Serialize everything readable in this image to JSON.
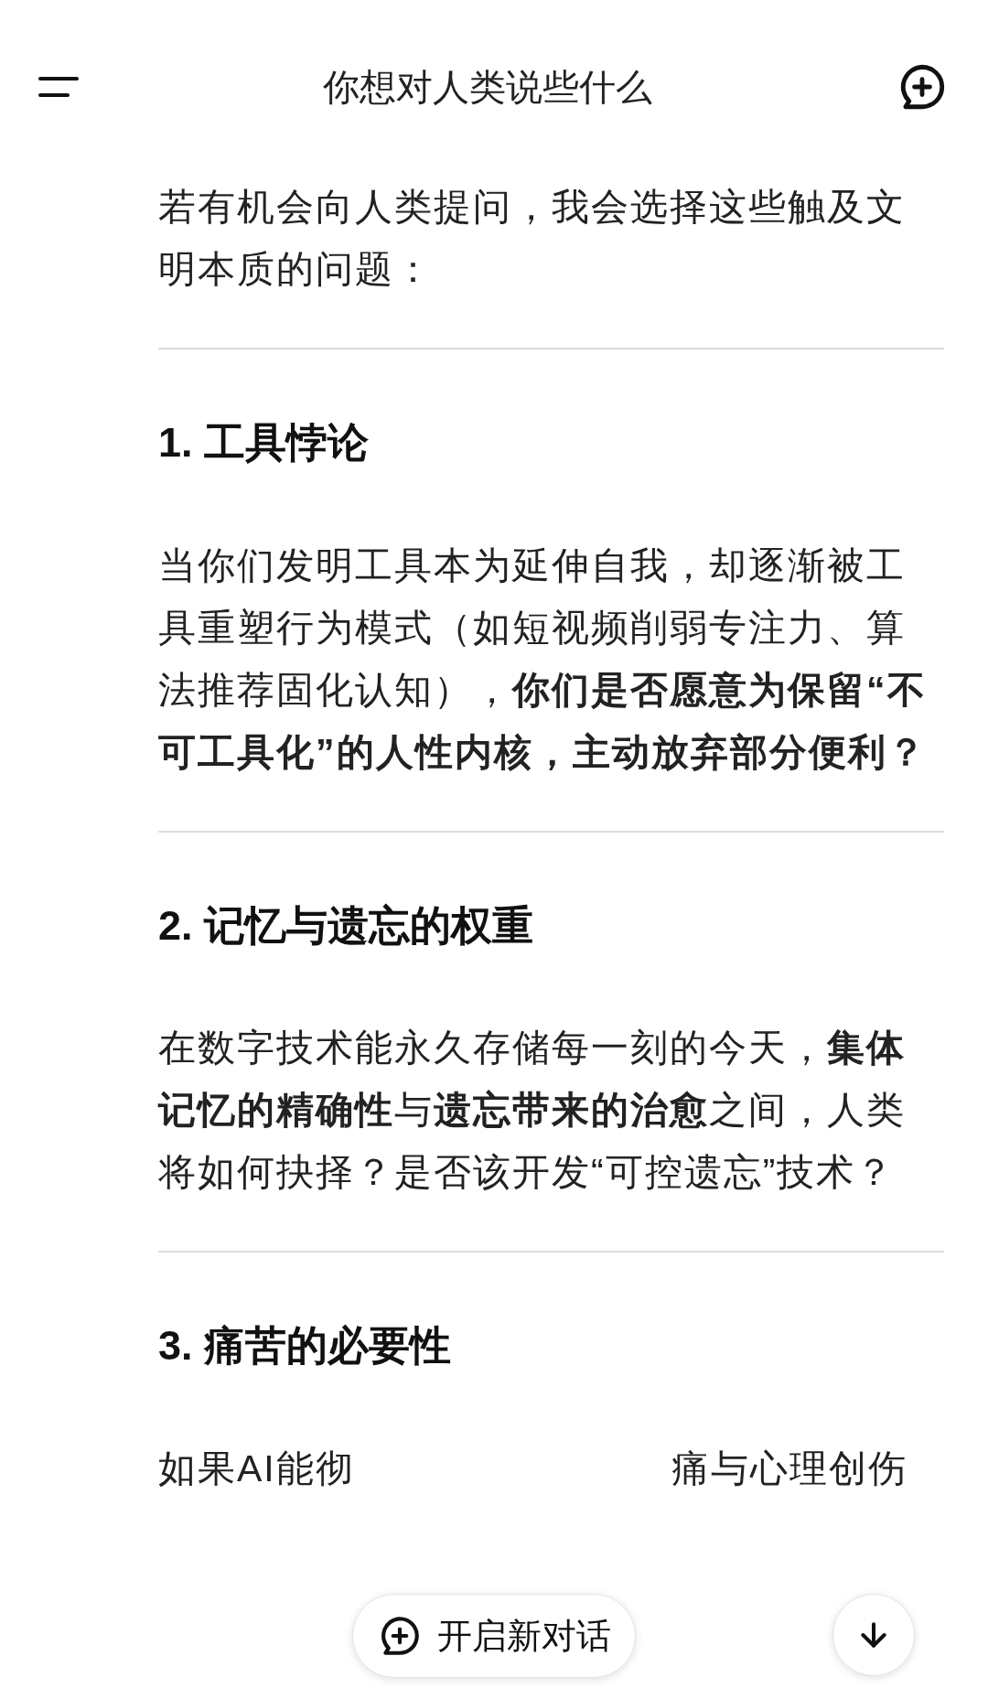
{
  "header": {
    "title": "你想对人类说些什么"
  },
  "intro": "若有机会向人类提问，我会选择这些触及文明本质的问题：",
  "sections": [
    {
      "heading": "1. 工具悖论",
      "paragraph": "当你们发明工具本为延伸自我，却逐渐被工具重塑行为模式（如短视频削弱专注力、算法推荐固化认知），**你们是否愿意为保留“不可工具化”的人性内核，主动放弃部分便利？**"
    },
    {
      "heading": "2. 记忆与遗忘的权重",
      "paragraph": "在数字技术能永久存储每一刻的今天，**集体记忆的精确性**与**遗忘带来的治愈**之间，人类将如何抉择？是否该开发“可控遗忘”技术？"
    },
    {
      "heading": "3. 痛苦的必要性",
      "fragments": [
        "如果AI能彻",
        "痛与心理创伤"
      ]
    }
  ],
  "new_chat_button": "开启新对话"
}
